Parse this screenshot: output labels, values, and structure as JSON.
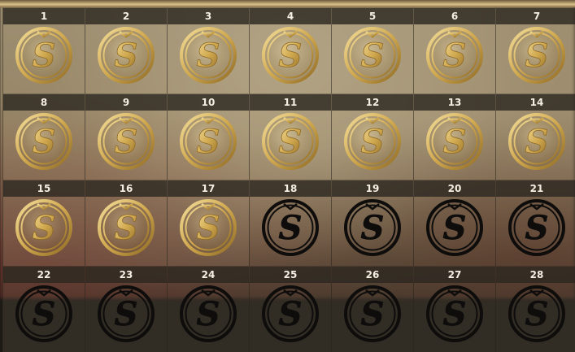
{
  "colors": {
    "gold_light": "#f2dd9a",
    "gold_mid": "#d1a94f",
    "gold_dark": "#8e6a25",
    "locked": "#0e0d0c",
    "label_text": "#f4efe2"
  },
  "coin_icon": "s-coin-icon",
  "tiles": [
    {
      "number": "1",
      "state": "unlocked"
    },
    {
      "number": "2",
      "state": "unlocked"
    },
    {
      "number": "3",
      "state": "unlocked"
    },
    {
      "number": "4",
      "state": "unlocked"
    },
    {
      "number": "5",
      "state": "unlocked"
    },
    {
      "number": "6",
      "state": "unlocked"
    },
    {
      "number": "7",
      "state": "unlocked"
    },
    {
      "number": "8",
      "state": "unlocked"
    },
    {
      "number": "9",
      "state": "unlocked"
    },
    {
      "number": "10",
      "state": "unlocked"
    },
    {
      "number": "11",
      "state": "unlocked"
    },
    {
      "number": "12",
      "state": "unlocked"
    },
    {
      "number": "13",
      "state": "unlocked"
    },
    {
      "number": "14",
      "state": "unlocked"
    },
    {
      "number": "15",
      "state": "unlocked"
    },
    {
      "number": "16",
      "state": "unlocked"
    },
    {
      "number": "17",
      "state": "unlocked"
    },
    {
      "number": "18",
      "state": "locked"
    },
    {
      "number": "19",
      "state": "locked"
    },
    {
      "number": "20",
      "state": "locked"
    },
    {
      "number": "21",
      "state": "locked"
    },
    {
      "number": "22",
      "state": "locked"
    },
    {
      "number": "23",
      "state": "locked"
    },
    {
      "number": "24",
      "state": "locked"
    },
    {
      "number": "25",
      "state": "locked"
    },
    {
      "number": "26",
      "state": "locked"
    },
    {
      "number": "27",
      "state": "locked"
    },
    {
      "number": "28",
      "state": "locked"
    }
  ]
}
